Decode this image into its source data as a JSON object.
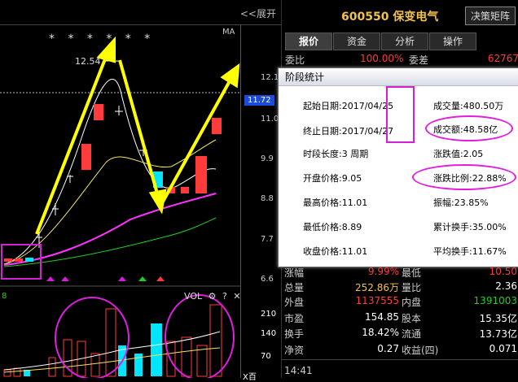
{
  "chart": {
    "expand_label": "<<展开",
    "stars": "* * *  *  * *",
    "ma_label": "MA",
    "peak_label": "12.54",
    "current_price": "11.72",
    "price_ticks": [
      "12.1",
      "11.0",
      "9.9",
      "8.8",
      "7.7",
      "6.6"
    ],
    "vol_label": "VOL",
    "vol_ticks": [
      "210",
      "140",
      "70"
    ],
    "vol_left_digit": "8",
    "axis_unit": "X百"
  },
  "stock": {
    "code_name": "600550 保变电气",
    "strategy_button": "决策矩阵",
    "tabs": [
      "报价",
      "资金",
      "分析",
      "操作"
    ],
    "weibi_label": "委比",
    "weibi_value": "100.00%",
    "weicha_label": "委差",
    "weicha_value": "62767"
  },
  "popup": {
    "title": "阶段统计",
    "start_date": "起始日期:2017/04/25",
    "end_date": "终止日期:2017/04/27",
    "duration": "时段长度:3 周期",
    "open_price": "开盘价格:9.05",
    "high_price": "最高价格:11.01",
    "low_price": "最低价格:8.89",
    "close_price": "收盘价格:11.01",
    "volume": "成交量:480.50万",
    "amount": "成交额:48.58亿",
    "change_value": "涨跌值:2.05",
    "change_pct": "涨跌比例:22.88%",
    "amplitude": "振幅:23.85%",
    "cum_turnover": "累计换手:35.00%",
    "avg_turnover": "平均换手:11.67%"
  },
  "quotes": [
    {
      "l1": "涨幅",
      "v1": "9.99%",
      "l2": "最低",
      "v2": "10.50"
    },
    {
      "l1": "总量",
      "v1": "252.86万",
      "l2": "量比",
      "v2": "2.36"
    },
    {
      "l1": "外盘",
      "v1": "1137555",
      "l2": "内盘",
      "v2": "1391003"
    },
    {
      "l1": "市盈",
      "v1": "154.85",
      "l2": "股本",
      "v2": "15.35亿"
    },
    {
      "l1": "换手",
      "v1": "18.42%",
      "l2": "流通",
      "v2": "13.73亿"
    },
    {
      "l1": "净资",
      "v1": "0.27",
      "l2": "收益(四)",
      "v2": "0.071"
    }
  ],
  "time": "14:41",
  "colors": {
    "up": "#ff3b3b",
    "down": "#00e5ff",
    "arrow": "#ffff00",
    "annotation": "#e01ee0"
  }
}
